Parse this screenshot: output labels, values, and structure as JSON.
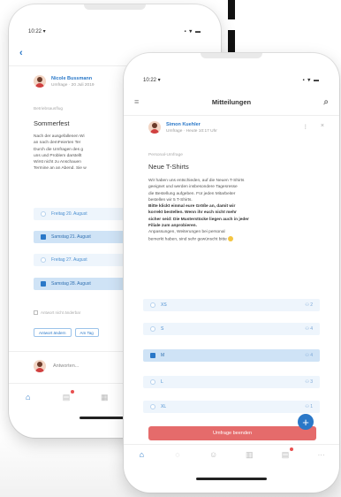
{
  "colors": {
    "accent": "#2a78c8",
    "danger": "#e56b6b",
    "option_light": "#eef5fc",
    "option_dark": "#cfe3f6"
  },
  "phone_back": {
    "status": {
      "time": "10:22 ▾",
      "signal": "▪ ▾ ▬"
    },
    "back_icon": "chevron-left-icon",
    "author": {
      "name": "Nicole Bussmann",
      "meta": "Umfrage · 20 Juli 2019"
    },
    "section_label": "Betriebsausflug",
    "title": "Sommerfest",
    "body_lines": [
      "Nach der ausgefallenen Wi",
      "an nach demFeierten Ter",
      "Durch die Umfragen des g",
      "uns und Problem darstellt",
      "Wirst nicht zu Anschauen",
      "Termine an an Abend. Sie w"
    ],
    "options": [
      {
        "label": "Freitag 20. August",
        "selected": false
      },
      {
        "label": "Samstag 21. August",
        "selected": true
      },
      {
        "label": "Freitag 27. August",
        "selected": false
      },
      {
        "label": "Samstag 28. August",
        "selected": true
      }
    ],
    "note": "Antwort nicht änderbar",
    "tags": [
      "Antwort ändern",
      "Am Tag"
    ],
    "reply_placeholder": "Antworten...",
    "tabs": [
      "home-icon",
      "chat-icon",
      "calendar-icon"
    ]
  },
  "phone_front": {
    "status": {
      "time": "10:22 ▾",
      "signal": "▪ ▾ ▬"
    },
    "header_title": "Mitteilungen",
    "menu_icon": "menu-icon",
    "search_icon": "search-icon",
    "author": {
      "name": "Simon Kuehler",
      "meta": "Umfrage · Heute 10:17 Uhr"
    },
    "section_label": "Personal-Umfrage",
    "title": "Neue T-Shirts",
    "body_lines": [
      "Wir haben uns entschieden, auf die Neuen T-Shirts",
      "geeignet und werden insbesondere Tagesresse",
      "die Bestellung aufgeben. Für jeden Mitarbeiter",
      "bestellen wir 5 T-Shirts."
    ],
    "body_bold_lines": [
      "Bitte klickt einmal eure Größe an, damit wir",
      "korrekt bestellen. Wenn ihr euch nicht mehr",
      "sicher seid: Die Musterstücke liegen auch in jeder",
      "Filiale zum anprobieren."
    ],
    "body_tail_lines": [
      "Anpassungen, Weiterungen bei personal",
      "bemerkt haben, sind sehr gewünscht bitte"
    ],
    "options": [
      {
        "label": "XS",
        "count": "2",
        "selected": false
      },
      {
        "label": "S",
        "count": "4",
        "selected": false
      },
      {
        "label": "M",
        "count": "4",
        "selected": true
      },
      {
        "label": "L",
        "count": "3",
        "selected": false
      },
      {
        "label": "XL",
        "count": "1",
        "selected": false
      }
    ],
    "count_icon": "people-icon",
    "submit_button": "Umfrage beenden",
    "fab_label": "+",
    "tabs": [
      "home-icon",
      "chat-icon",
      "smile-icon",
      "book-icon",
      "bell-icon",
      "more-icon"
    ],
    "more_label": "···"
  }
}
